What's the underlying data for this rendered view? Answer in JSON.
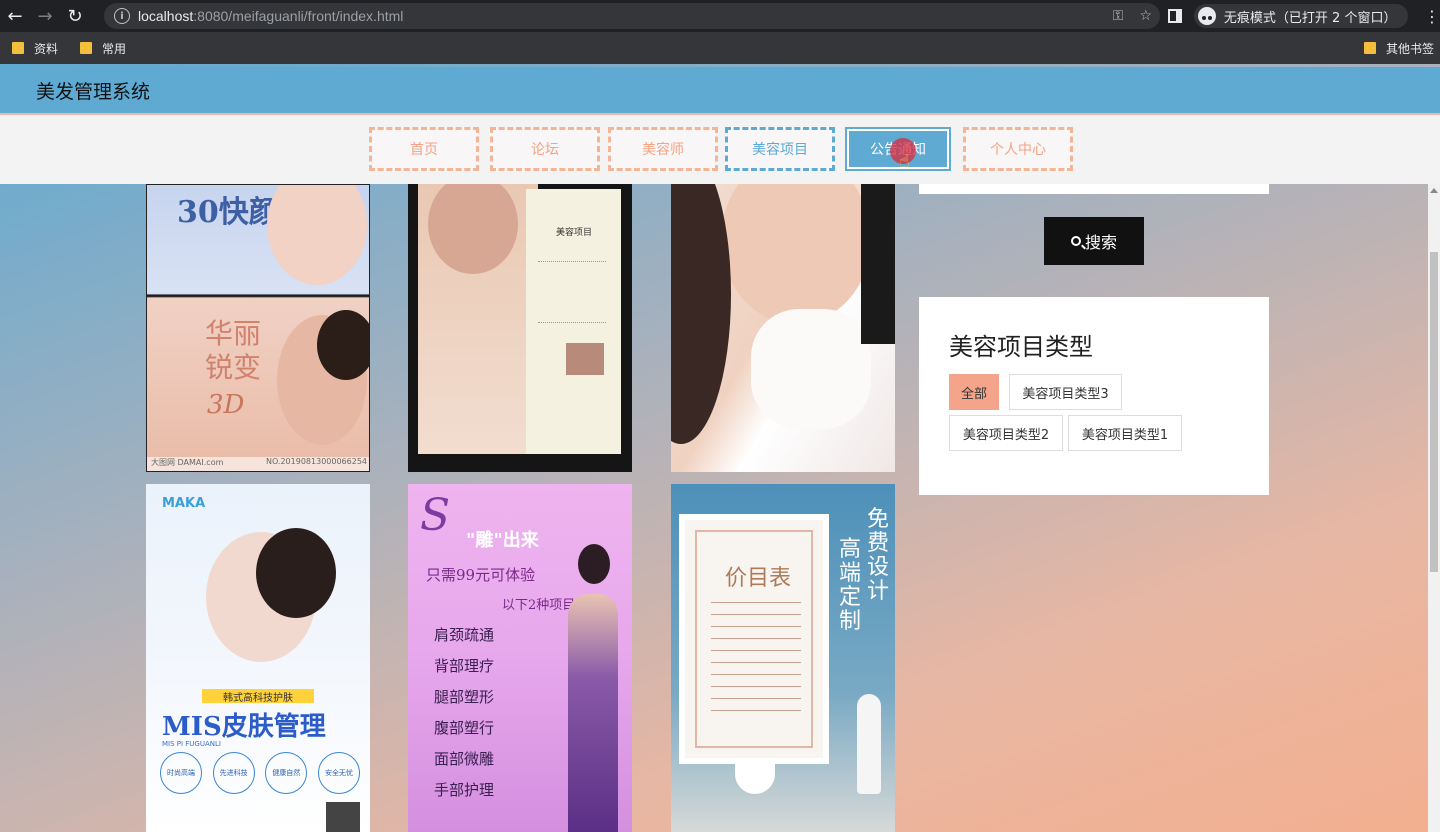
{
  "browser": {
    "url_host": "localhost",
    "url_rest": ":8080/meifaguanli/front/index.html",
    "incognito_label": "无痕模式（已打开 2 个窗口）",
    "bookmarks": [
      "资料",
      "常用"
    ],
    "other_bookmarks": "其他书签"
  },
  "header": {
    "title": "美发管理系统"
  },
  "nav": {
    "items": [
      "首页",
      "论坛",
      "美容师",
      "美容项目",
      "公告通知",
      "个人中心"
    ],
    "current": "美容项目",
    "hovered": "公告通知"
  },
  "posters": {
    "p1": {
      "top_text": "30快颜",
      "main": "华丽锐变",
      "sub": "3D",
      "foot_left": "大图网 DAMAI.com",
      "foot_right": "NO.20190813000066254"
    },
    "p2": {
      "menu_title": "美容项目"
    },
    "p4": {
      "brand": "MAKA",
      "banner": "韩式高科技护肤",
      "title": "MIS皮肤管理",
      "sub": "MIS PI FUGUANLI",
      "badges": [
        "时尚高端",
        "先进科技",
        "健康自然",
        "安全无忧"
      ]
    },
    "p5": {
      "letter": "S",
      "headline": "\"雕\"出来",
      "price_line": "只需99元可体验",
      "second_line": "以下2种项目",
      "items": [
        "肩颈疏通",
        "背部理疗",
        "腿部塑形",
        "腹部塑行",
        "面部微雕",
        "手部护理"
      ]
    },
    "p6": {
      "board_title": "价目表",
      "vertical_1": "免费设计",
      "vertical_2": "高端定制"
    }
  },
  "search": {
    "button_label": "搜索"
  },
  "categories": {
    "title": "美容项目类型",
    "tags": [
      "全部",
      "美容项目类型3",
      "美容项目类型2",
      "美容项目类型1"
    ],
    "active": "全部"
  },
  "colors": {
    "accent_blue": "#5eaad3",
    "accent_peach": "#f4a48a"
  }
}
